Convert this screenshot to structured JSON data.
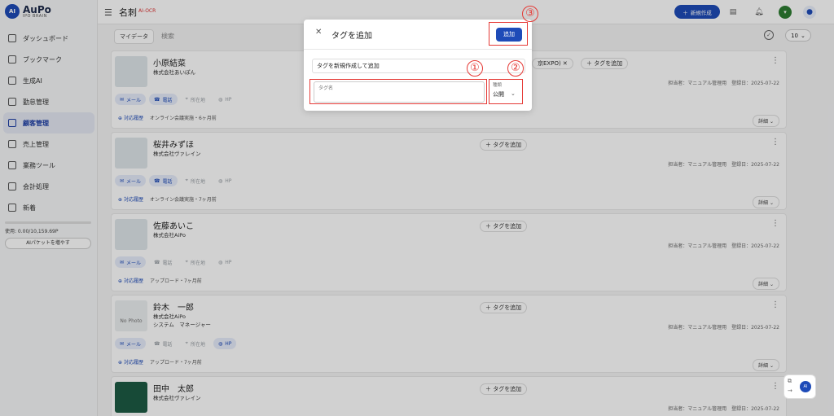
{
  "app": {
    "logo_badge": "AI",
    "logo_name": "AuPo",
    "logo_sub": "IPO BRAIN"
  },
  "sidebar": {
    "items": [
      {
        "label": "ダッシュボード",
        "icon": "dashboard-icon"
      },
      {
        "label": "ブックマーク",
        "icon": "bookmark-icon"
      },
      {
        "label": "生成AI",
        "icon": "ai-icon"
      },
      {
        "label": "勤怠管理",
        "icon": "attendance-icon"
      },
      {
        "label": "顧客管理",
        "icon": "customer-icon",
        "active": true
      },
      {
        "label": "売上管理",
        "icon": "sales-icon"
      },
      {
        "label": "業務ツール",
        "icon": "tools-icon"
      },
      {
        "label": "会計処理",
        "icon": "accounting-icon"
      },
      {
        "label": "新着",
        "icon": "new-icon"
      }
    ],
    "usage_text": "使用: 0.00/10,159.69P",
    "usage_button": "AIパケットを増やす"
  },
  "header": {
    "title": "名刺",
    "badge": "AI-OCR",
    "new_button": "新規作成"
  },
  "filter": {
    "select_label": "マイデータ",
    "search_placeholder": "検索",
    "per_page": "10"
  },
  "cards": [
    {
      "name": "小原結菜",
      "company": "株式会社あいぽん",
      "role": "",
      "history": "対応履歴",
      "history_note": "オンライン会議実施・6ヶ月前",
      "tag_add": "＋ タグを追加",
      "extra_tag": "京EXPO)",
      "meta": "担当者：マニュアル管理用　登録日：2025-07-22",
      "detail": "詳細",
      "thumb": "card"
    },
    {
      "name": "桜井みずほ",
      "company": "株式会社ヴァレイン",
      "role": "",
      "history": "対応履歴",
      "history_note": "オンライン会議実施・7ヶ月前",
      "tag_add": "＋ タグを追加",
      "meta": "担当者：マニュアル管理用　登録日：2025-07-22",
      "detail": "詳細",
      "thumb": "card"
    },
    {
      "name": "佐藤あいこ",
      "company": "株式会社AiPo",
      "role": "",
      "history": "対応履歴",
      "history_note": "アップロード・7ヶ月前",
      "tag_add": "＋ タグを追加",
      "meta": "担当者：マニュアル管理用　登録日：2025-07-22",
      "detail": "詳細",
      "thumb": "card"
    },
    {
      "name": "鈴木　一郎",
      "company": "株式会社AiPo",
      "role": "システム　マネージャー",
      "history": "対応履歴",
      "history_note": "アップロード・7ヶ月前",
      "tag_add": "＋ タグを追加",
      "meta": "担当者：マニュアル管理用　登録日：2025-07-22",
      "detail": "詳細",
      "thumb": "nophoto",
      "nophoto": "No Photo"
    },
    {
      "name": "田中　太郎",
      "company": "株式会社ヴァレイン",
      "role": "",
      "history": "",
      "history_note": "",
      "tag_add": "＋ タグを追加",
      "meta": "担当者：マニュアル管理用　登録日：2025-07-22",
      "detail": "",
      "thumb": "dark"
    }
  ],
  "chips": {
    "mail": "メール",
    "phone": "電話",
    "address": "所在地",
    "hp": "HP"
  },
  "modal": {
    "title": "タグを追加",
    "add_button": "追加",
    "new_tag_field": "タグを新規作成して追加",
    "tag_name_label": "タグ名",
    "type_label": "種類",
    "type_value": "公開"
  },
  "annotations": {
    "m1": "①",
    "m2": "②",
    "m3": "③"
  },
  "colors": {
    "accent": "#1e4bb8",
    "annotation": "#e53935"
  }
}
